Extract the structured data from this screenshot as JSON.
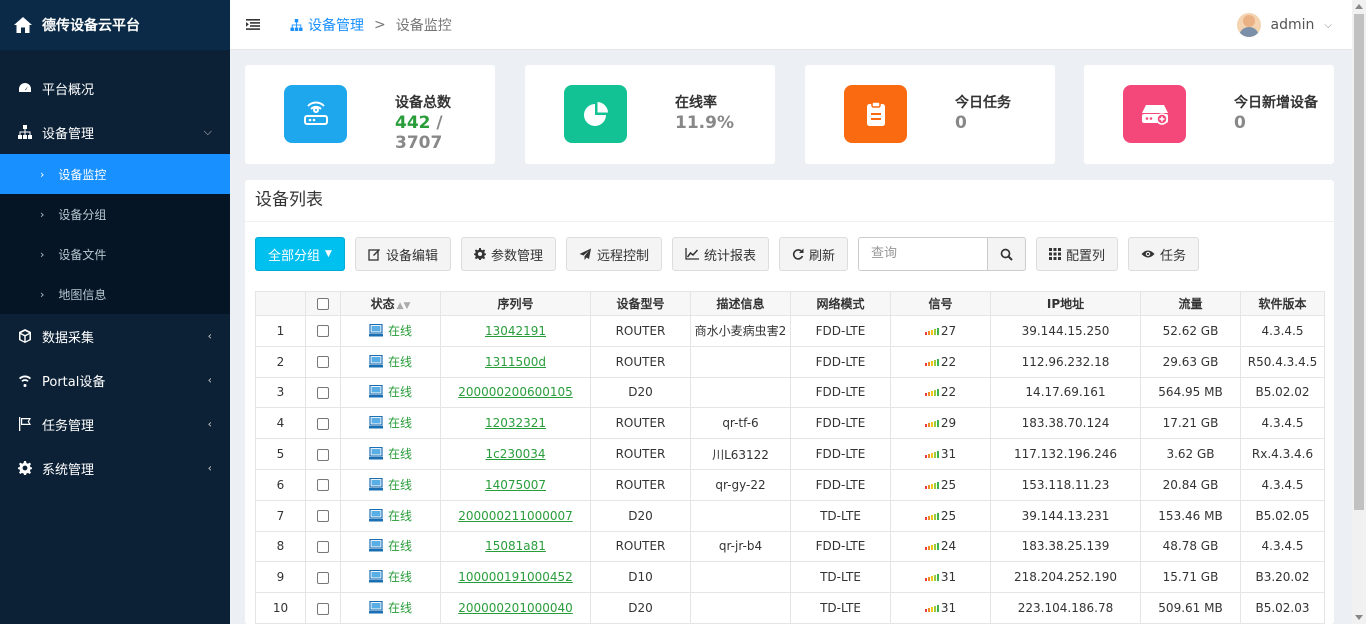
{
  "brand": {
    "title": "德传设备云平台"
  },
  "sidebar": {
    "items": [
      {
        "label": "平台概况",
        "icon": "dashboard-icon"
      },
      {
        "label": "设备管理",
        "icon": "sitemap-icon",
        "expanded": true,
        "children": [
          {
            "label": "设备监控",
            "active": true
          },
          {
            "label": "设备分组"
          },
          {
            "label": "设备文件"
          },
          {
            "label": "地图信息"
          }
        ]
      },
      {
        "label": "数据采集",
        "icon": "cube-icon"
      },
      {
        "label": "Portal设备",
        "icon": "wifi-icon"
      },
      {
        "label": "任务管理",
        "icon": "flag-icon"
      },
      {
        "label": "系统管理",
        "icon": "gear-icon"
      }
    ]
  },
  "header": {
    "breadcrumb": {
      "level1": "设备管理",
      "separator": ">",
      "level2": "设备监控"
    },
    "user": "admin"
  },
  "cards": [
    {
      "title": "设备总数",
      "value_online": "442",
      "value_sep": " / ",
      "value_total": "3707",
      "color": "#1ea7ec",
      "icon": "router-icon"
    },
    {
      "title": "在线率",
      "value": "11.9%",
      "color": "#12c294",
      "icon": "pie-chart-icon"
    },
    {
      "title": "今日任务",
      "value": "0",
      "color": "#f96a11",
      "icon": "clipboard-icon"
    },
    {
      "title": "今日新增设备",
      "value": "0",
      "color": "#f4487a",
      "icon": "add-device-icon"
    }
  ],
  "panel": {
    "title": "设备列表"
  },
  "toolbar": {
    "group_label": "全部分组",
    "edit_label": "设备编辑",
    "params_label": "参数管理",
    "remote_label": "远程控制",
    "report_label": "统计报表",
    "refresh_label": "刷新",
    "search_placeholder": "查询",
    "columns_label": "配置列",
    "task_label": "任务"
  },
  "table": {
    "headers": [
      "",
      "",
      "状态",
      "序列号",
      "设备型号",
      "描述信息",
      "网络模式",
      "信号",
      "IP地址",
      "流量",
      "软件版本"
    ],
    "rows": [
      {
        "no": "1",
        "status": "在线",
        "serial": "13042191",
        "model": "ROUTER",
        "desc": "商水小麦病虫害2",
        "net": "FDD-LTE",
        "signal": "27",
        "ip": "39.144.15.250",
        "flow": "52.62 GB",
        "ver": "4.3.4.5"
      },
      {
        "no": "2",
        "status": "在线",
        "serial": "1311500d",
        "model": "ROUTER",
        "desc": "",
        "net": "FDD-LTE",
        "signal": "22",
        "ip": "112.96.232.18",
        "flow": "29.63 GB",
        "ver": "R50.4.3.4.5"
      },
      {
        "no": "3",
        "status": "在线",
        "serial": "200000200600105",
        "model": "D20",
        "desc": "",
        "net": "FDD-LTE",
        "signal": "22",
        "ip": "14.17.69.161",
        "flow": "564.95 MB",
        "ver": "B5.02.02"
      },
      {
        "no": "4",
        "status": "在线",
        "serial": "12032321",
        "model": "ROUTER",
        "desc": "qr-tf-6",
        "net": "FDD-LTE",
        "signal": "29",
        "ip": "183.38.70.124",
        "flow": "17.21 GB",
        "ver": "4.3.4.5"
      },
      {
        "no": "5",
        "status": "在线",
        "serial": "1c230034",
        "model": "ROUTER",
        "desc": "川L63122",
        "net": "FDD-LTE",
        "signal": "31",
        "ip": "117.132.196.246",
        "flow": "3.62 GB",
        "ver": "Rx.4.3.4.6"
      },
      {
        "no": "6",
        "status": "在线",
        "serial": "14075007",
        "model": "ROUTER",
        "desc": "qr-gy-22",
        "net": "FDD-LTE",
        "signal": "25",
        "ip": "153.118.11.23",
        "flow": "20.84 GB",
        "ver": "4.3.4.5"
      },
      {
        "no": "7",
        "status": "在线",
        "serial": "200000211000007",
        "model": "D20",
        "desc": "",
        "net": "TD-LTE",
        "signal": "25",
        "ip": "39.144.13.231",
        "flow": "153.46 MB",
        "ver": "B5.02.05"
      },
      {
        "no": "8",
        "status": "在线",
        "serial": "15081a81",
        "model": "ROUTER",
        "desc": "qr-jr-b4",
        "net": "FDD-LTE",
        "signal": "24",
        "ip": "183.38.25.139",
        "flow": "48.78 GB",
        "ver": "4.3.4.5"
      },
      {
        "no": "9",
        "status": "在线",
        "serial": "100000191000452",
        "model": "D10",
        "desc": "",
        "net": "TD-LTE",
        "signal": "31",
        "ip": "218.204.252.190",
        "flow": "15.71 GB",
        "ver": "B3.20.02"
      },
      {
        "no": "10",
        "status": "在线",
        "serial": "200000201000040",
        "model": "D20",
        "desc": "",
        "net": "TD-LTE",
        "signal": "31",
        "ip": "223.104.186.78",
        "flow": "509.61 MB",
        "ver": "B5.02.03"
      }
    ]
  }
}
